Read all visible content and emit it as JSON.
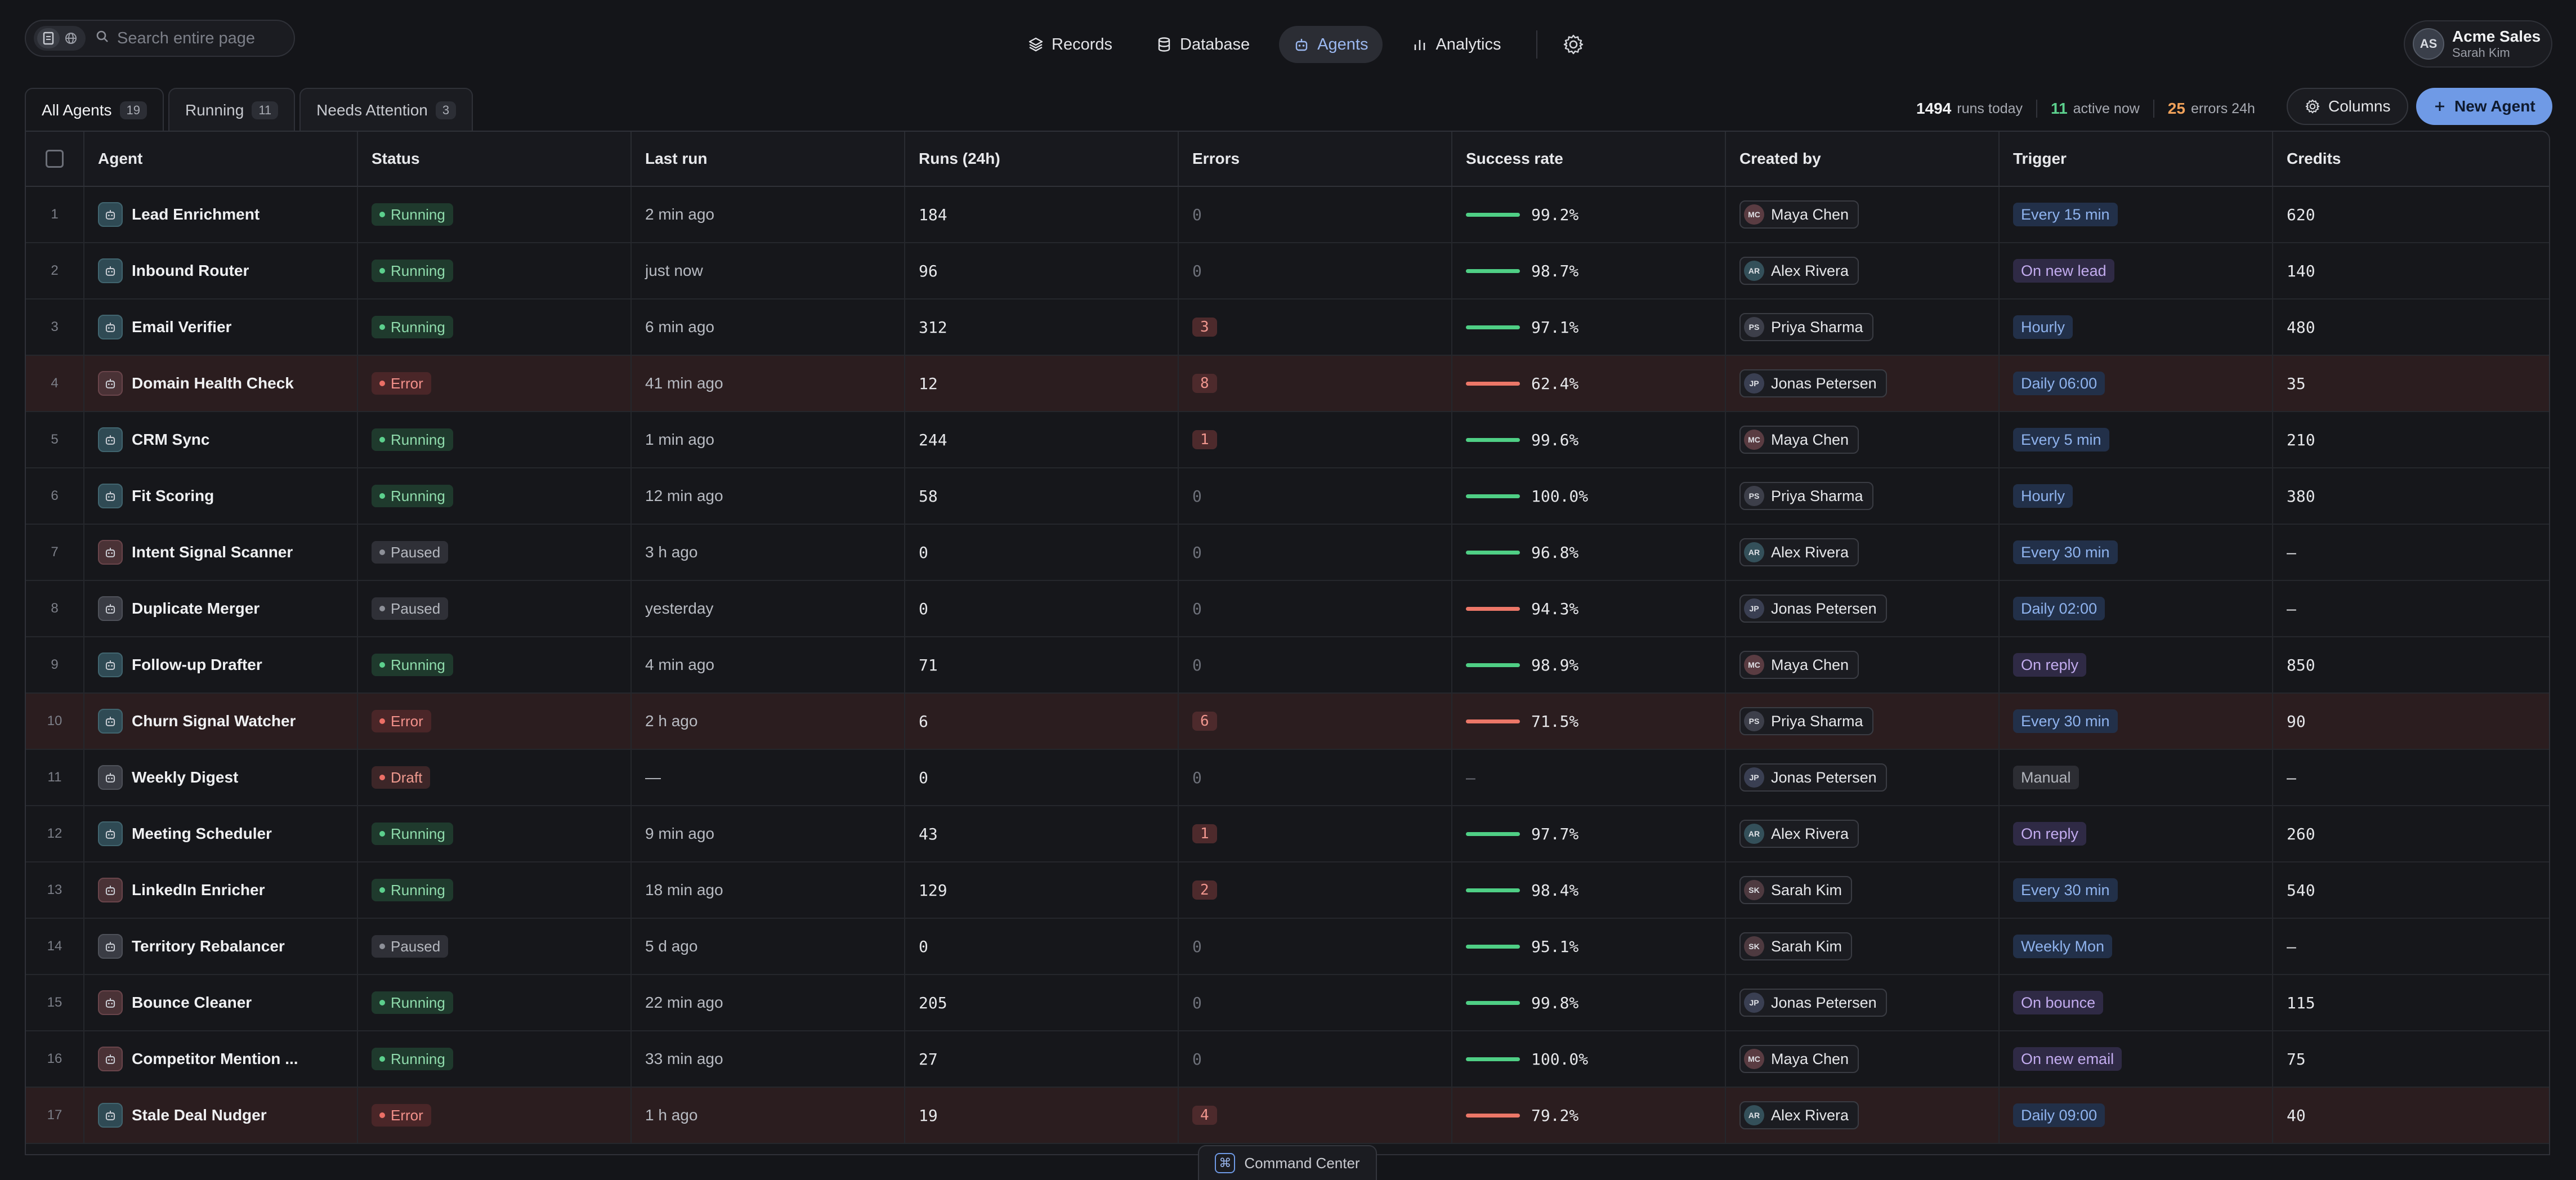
{
  "search": {
    "placeholder": "Search entire page"
  },
  "nav": [
    {
      "label": "Records",
      "icon": "layers-icon",
      "active": false
    },
    {
      "label": "Database",
      "icon": "database-icon",
      "active": false
    },
    {
      "label": "Agents",
      "icon": "robot-icon",
      "active": true
    },
    {
      "label": "Analytics",
      "icon": "bar-chart-icon",
      "active": false
    }
  ],
  "account": {
    "initials": "AS",
    "name": "Acme Sales",
    "user": "Sarah Kim"
  },
  "tabs": [
    {
      "label": "All Agents",
      "count": "19",
      "active": true
    },
    {
      "label": "Running",
      "count": "11",
      "active": false
    },
    {
      "label": "Needs Attention",
      "count": "3",
      "active": false
    }
  ],
  "stats": {
    "runs_today": "1494",
    "runs_today_label": "runs today",
    "active_now": "11",
    "active_now_label": "active now",
    "errors": "25",
    "errors_label": "errors 24h"
  },
  "buttons": {
    "columns": "Columns",
    "new_agent": "New Agent"
  },
  "columns": [
    "Agent",
    "Status",
    "Last run",
    "Runs (24h)",
    "Errors",
    "Success rate",
    "Created by",
    "Trigger",
    "Credits"
  ],
  "colors": {
    "accent": "#6f9ae6",
    "success": "#4fcf85",
    "error": "#ec6f66"
  },
  "rows": [
    {
      "idx": "1",
      "name": "Lead Enrichment",
      "icon_tone": "ok",
      "status": "Running",
      "last_run": "2 min ago",
      "runs": "184",
      "errors": "0",
      "rate": "99.2%",
      "rate_tone": "good",
      "creator": "Maya Chen",
      "creator_initials": "MC",
      "av": "mc",
      "trigger": "Every 15 min",
      "trigger_tone": "blue",
      "credits": "620"
    },
    {
      "idx": "2",
      "name": "Inbound Router",
      "icon_tone": "ok",
      "status": "Running",
      "last_run": "just now",
      "runs": "96",
      "errors": "0",
      "rate": "98.7%",
      "rate_tone": "good",
      "creator": "Alex Rivera",
      "creator_initials": "AR",
      "av": "ar",
      "trigger": "On new lead",
      "trigger_tone": "purple",
      "credits": "140"
    },
    {
      "idx": "3",
      "name": "Email Verifier",
      "icon_tone": "ok",
      "status": "Running",
      "last_run": "6 min ago",
      "runs": "312",
      "errors": "3",
      "rate": "97.1%",
      "rate_tone": "good",
      "creator": "Priya Sharma",
      "creator_initials": "PS",
      "av": "ps",
      "trigger": "Hourly",
      "trigger_tone": "blue",
      "credits": "480"
    },
    {
      "idx": "4",
      "name": "Domain Health Check",
      "icon_tone": "bad",
      "status": "Error",
      "last_run": "41 min ago",
      "runs": "12",
      "errors": "8",
      "rate": "62.4%",
      "rate_tone": "bad",
      "creator": "Jonas Petersen",
      "creator_initials": "JP",
      "av": "jp",
      "trigger": "Daily 06:00",
      "trigger_tone": "blue",
      "credits": "35"
    },
    {
      "idx": "5",
      "name": "CRM Sync",
      "icon_tone": "ok",
      "status": "Running",
      "last_run": "1 min ago",
      "runs": "244",
      "errors": "1",
      "rate": "99.6%",
      "rate_tone": "good",
      "creator": "Maya Chen",
      "creator_initials": "MC",
      "av": "mc",
      "trigger": "Every 5 min",
      "trigger_tone": "blue",
      "credits": "210"
    },
    {
      "idx": "6",
      "name": "Fit Scoring",
      "icon_tone": "ok",
      "status": "Running",
      "last_run": "12 min ago",
      "runs": "58",
      "errors": "0",
      "rate": "100.0%",
      "rate_tone": "good",
      "creator": "Priya Sharma",
      "creator_initials": "PS",
      "av": "ps",
      "trigger": "Hourly",
      "trigger_tone": "blue",
      "credits": "380"
    },
    {
      "idx": "7",
      "name": "Intent Signal Scanner",
      "icon_tone": "bad",
      "status": "Paused",
      "last_run": "3 h ago",
      "runs": "0",
      "errors": "0",
      "rate": "96.8%",
      "rate_tone": "good",
      "creator": "Alex Rivera",
      "creator_initials": "AR",
      "av": "ar",
      "trigger": "Every 30 min",
      "trigger_tone": "blue",
      "credits": "—"
    },
    {
      "idx": "8",
      "name": "Duplicate Merger",
      "icon_tone": "neutral",
      "status": "Paused",
      "last_run": "yesterday",
      "runs": "0",
      "errors": "0",
      "rate": "94.3%",
      "rate_tone": "bad",
      "creator": "Jonas Petersen",
      "creator_initials": "JP",
      "av": "jp",
      "trigger": "Daily 02:00",
      "trigger_tone": "blue",
      "credits": "—"
    },
    {
      "idx": "9",
      "name": "Follow-up Drafter",
      "icon_tone": "ok",
      "status": "Running",
      "last_run": "4 min ago",
      "runs": "71",
      "errors": "0",
      "rate": "98.9%",
      "rate_tone": "good",
      "creator": "Maya Chen",
      "creator_initials": "MC",
      "av": "mc",
      "trigger": "On reply",
      "trigger_tone": "purple",
      "credits": "850"
    },
    {
      "idx": "10",
      "name": "Churn Signal Watcher",
      "icon_tone": "ok",
      "status": "Error",
      "last_run": "2 h ago",
      "runs": "6",
      "errors": "6",
      "rate": "71.5%",
      "rate_tone": "bad",
      "creator": "Priya Sharma",
      "creator_initials": "PS",
      "av": "ps",
      "trigger": "Every 30 min",
      "trigger_tone": "blue",
      "credits": "90"
    },
    {
      "idx": "11",
      "name": "Weekly Digest",
      "icon_tone": "neutral",
      "status": "Draft",
      "last_run": "—",
      "runs": "0",
      "errors": "0",
      "rate": "—",
      "rate_tone": "none",
      "creator": "Jonas Petersen",
      "creator_initials": "JP",
      "av": "jp",
      "trigger": "Manual",
      "trigger_tone": "gray",
      "credits": "—"
    },
    {
      "idx": "12",
      "name": "Meeting Scheduler",
      "icon_tone": "ok",
      "status": "Running",
      "last_run": "9 min ago",
      "runs": "43",
      "errors": "1",
      "rate": "97.7%",
      "rate_tone": "good",
      "creator": "Alex Rivera",
      "creator_initials": "AR",
      "av": "ar",
      "trigger": "On reply",
      "trigger_tone": "purple",
      "credits": "260"
    },
    {
      "idx": "13",
      "name": "LinkedIn Enricher",
      "icon_tone": "bad",
      "status": "Running",
      "last_run": "18 min ago",
      "runs": "129",
      "errors": "2",
      "rate": "98.4%",
      "rate_tone": "good",
      "creator": "Sarah Kim",
      "creator_initials": "SK",
      "av": "sk",
      "trigger": "Every 30 min",
      "trigger_tone": "blue",
      "credits": "540"
    },
    {
      "idx": "14",
      "name": "Territory Rebalancer",
      "icon_tone": "neutral",
      "status": "Paused",
      "last_run": "5 d ago",
      "runs": "0",
      "errors": "0",
      "rate": "95.1%",
      "rate_tone": "good",
      "creator": "Sarah Kim",
      "creator_initials": "SK",
      "av": "sk",
      "trigger": "Weekly Mon",
      "trigger_tone": "blue",
      "credits": "—"
    },
    {
      "idx": "15",
      "name": "Bounce Cleaner",
      "icon_tone": "bad",
      "status": "Running",
      "last_run": "22 min ago",
      "runs": "205",
      "errors": "0",
      "rate": "99.8%",
      "rate_tone": "good",
      "creator": "Jonas Petersen",
      "creator_initials": "JP",
      "av": "jp",
      "trigger": "On bounce",
      "trigger_tone": "purple",
      "credits": "115"
    },
    {
      "idx": "16",
      "name": "Competitor Mention ...",
      "icon_tone": "bad",
      "status": "Running",
      "last_run": "33 min ago",
      "runs": "27",
      "errors": "0",
      "rate": "100.0%",
      "rate_tone": "good",
      "creator": "Maya Chen",
      "creator_initials": "MC",
      "av": "mc",
      "trigger": "On new email",
      "trigger_tone": "purple",
      "credits": "75"
    },
    {
      "idx": "17",
      "name": "Stale Deal Nudger",
      "icon_tone": "ok",
      "status": "Error",
      "last_run": "1 h ago",
      "runs": "19",
      "errors": "4",
      "rate": "79.2%",
      "rate_tone": "bad",
      "creator": "Alex Rivera",
      "creator_initials": "AR",
      "av": "ar",
      "trigger": "Daily 09:00",
      "trigger_tone": "blue",
      "credits": "40"
    }
  ],
  "command_center": {
    "key": "⌘",
    "label": "Command Center"
  }
}
